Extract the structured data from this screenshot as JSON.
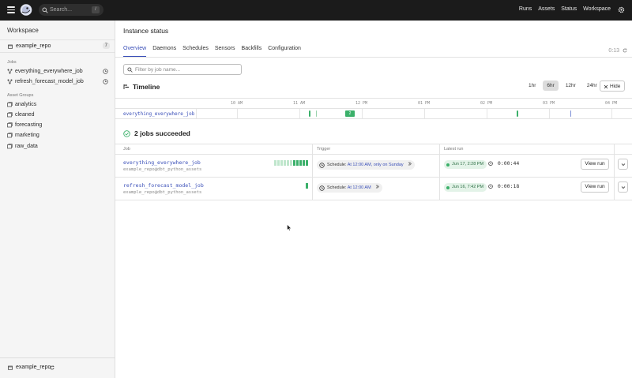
{
  "topbar": {
    "search_placeholder": "Search...",
    "search_shortcut": "/",
    "nav": [
      "Runs",
      "Assets",
      "Status",
      "Workspace"
    ]
  },
  "sidebar": {
    "title": "Workspace",
    "repo": {
      "name": "example_repo",
      "count": "7"
    },
    "jobs_heading": "Jobs",
    "jobs": [
      "everything_everywhere_job",
      "refresh_forecast_model_job"
    ],
    "asset_groups_heading": "Asset Groups",
    "asset_groups": [
      "analytics",
      "cleaned",
      "forecasting",
      "marketing",
      "raw_data"
    ],
    "footer_repo": "example_repo"
  },
  "main": {
    "title": "Instance status",
    "tabs": [
      "Overview",
      "Daemons",
      "Schedules",
      "Sensors",
      "Backfills",
      "Configuration"
    ],
    "active_tab": "Overview",
    "refresh_timer": "0:13",
    "filter_placeholder": "Filter by job name...",
    "timeline": {
      "title": "Timeline",
      "ranges": [
        "1hr",
        "6hr",
        "12hr",
        "24hr"
      ],
      "active_range": "6hr",
      "hide_label": "Hide",
      "ticks": [
        "10 AM",
        "11 AM",
        "12 PM",
        "01 PM",
        "02 PM",
        "03 PM",
        "04 PM"
      ],
      "row_job": "everything_everywhere_job",
      "grouped_runs_count": "2"
    },
    "summary": "2 jobs succeeded",
    "table": {
      "headers": {
        "job": "Job",
        "trigger": "Trigger",
        "latest_run": "Latest run"
      },
      "rows": [
        {
          "name": "everything_everywhere_job",
          "sub": "example_repo@dbt_python_assets",
          "schedule_prefix": "Schedule:",
          "schedule_value": "At 12:00 AM, only on Sunday",
          "run_date": "Jun 17, 2:28 PM",
          "duration": "0:00:44",
          "action": "View run"
        },
        {
          "name": "refresh_forecast_model_job",
          "sub": "example_repo@dbt_python_assets",
          "schedule_prefix": "Schedule:",
          "schedule_value": "At 12:00 AM",
          "run_date": "Jun 16, 7:42 PM",
          "duration": "0:00:18",
          "action": "View run"
        }
      ]
    }
  },
  "colors": {
    "accent": "#3a4fb8",
    "success": "#3bb06a",
    "topbar": "#1b1b1b"
  }
}
